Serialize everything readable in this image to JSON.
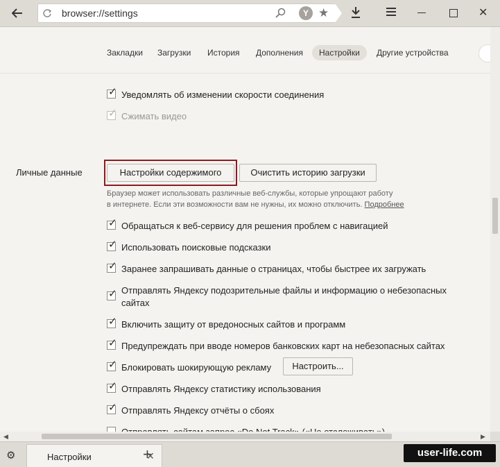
{
  "address": {
    "url": "browser://settings",
    "yandex_letter": "Y"
  },
  "nav": {
    "tabs": [
      "Закладки",
      "Загрузки",
      "История",
      "Дополнения",
      "Настройки",
      "Другие устройства"
    ],
    "active": "Настройки"
  },
  "top_options": [
    {
      "label": "Уведомлять об изменении скорости соединения",
      "checked": true,
      "disabled": false
    },
    {
      "label": "Сжимать видео",
      "checked": true,
      "disabled": true
    }
  ],
  "personal": {
    "section_label": "Личные данные",
    "content_settings_label": "Настройки содержимого",
    "clear_history_label": "Очистить историю загрузки",
    "hint_line1": "Браузер может использовать различные веб-службы, которые упрощают работу",
    "hint_line2": "в интернете. Если эти возможности вам не нужны, их можно отключить.",
    "hint_more": "Подробнее",
    "configure_label": "Настроить...",
    "options": [
      {
        "label": "Обращаться к веб-сервису для решения проблем с навигацией",
        "checked": true
      },
      {
        "label": "Использовать поисковые подсказки",
        "checked": true
      },
      {
        "label": "Заранее запрашивать данные о страницах, чтобы быстрее их загружать",
        "checked": true
      },
      {
        "label": "Отправлять Яндексу подозрительные файлы и информацию о небезопасных сайтах",
        "checked": true
      },
      {
        "label": "Включить защиту от вредоносных сайтов и программ",
        "checked": true
      },
      {
        "label": "Предупреждать при вводе номеров банковских карт на небезопасных сайтах",
        "checked": true
      },
      {
        "label": "Блокировать шокирующую рекламу",
        "checked": true
      },
      {
        "label": "Отправлять Яндексу статистику использования",
        "checked": true
      },
      {
        "label": "Отправлять Яндексу отчёты о сбоях",
        "checked": true
      },
      {
        "label": "Отправлять сайтам запрос «Do Not Track» («Не отслеживать»)",
        "checked": false
      }
    ]
  },
  "tabbar": {
    "tab_title": "Настройки"
  },
  "watermark": "user-life.com"
}
